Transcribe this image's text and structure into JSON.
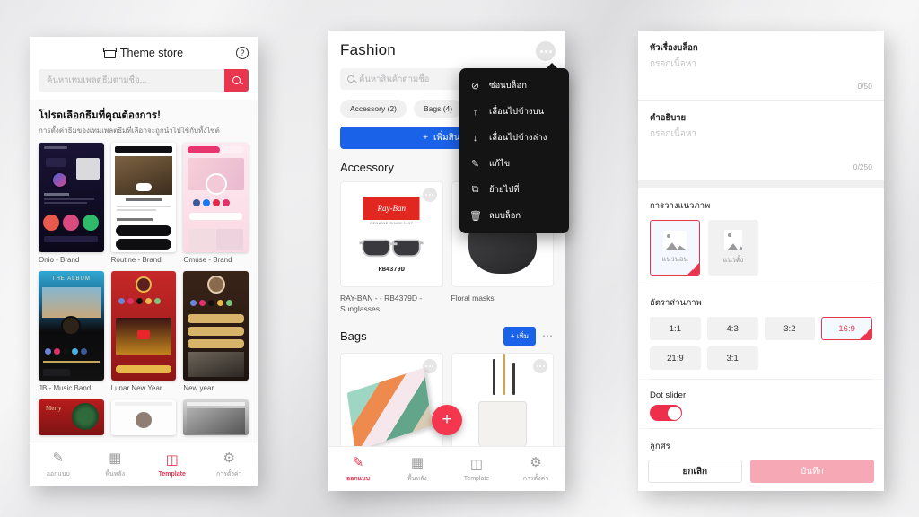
{
  "theme_store": {
    "title": "Theme store",
    "store_icon": "store-icon",
    "help_icon": "question-mark-icon",
    "search_placeholder": "ค้นหาเทมเพลตธีมตามชื่อ...",
    "search_icon": "search-icon",
    "heading": "โปรดเลือกธีมที่คุณต้องการ!",
    "subheading": "การตั้งค่าธีมของเทมเพลตธีมที่เลือกจะถูกนำไปใช้กับทั้งไซต์",
    "cards": [
      {
        "name": "Onio - Brand",
        "style": "th-onio"
      },
      {
        "name": "Routine - Brand",
        "style": "th-routine"
      },
      {
        "name": "Omuse - Brand",
        "style": "th-omuse"
      },
      {
        "name": "JB - Music Band",
        "style": "th-jb"
      },
      {
        "name": "Lunar New Year",
        "style": "th-lunar"
      },
      {
        "name": "New year",
        "style": "th-newyear"
      },
      {
        "name": "",
        "style": "th-xmas"
      },
      {
        "name": "",
        "style": "th-white"
      },
      {
        "name": "",
        "style": "th-gym"
      }
    ],
    "bottom_nav": [
      {
        "label": "ออกแบบ",
        "icon": "brush-icon",
        "glyph": "✎",
        "active": false
      },
      {
        "label": "พื้นหลัง",
        "icon": "image-icon",
        "glyph": "⛰",
        "active": false
      },
      {
        "label": "Template",
        "icon": "template-icon",
        "glyph": "◫",
        "active": true
      },
      {
        "label": "การตั้งค่า",
        "icon": "gear-icon",
        "glyph": "⚙",
        "active": false
      }
    ]
  },
  "fashion": {
    "title": "Fashion",
    "more_icon": "more-options-icon",
    "search_placeholder": "ค้นหาสินค้าตามชื่อ",
    "search_icon": "search-icon",
    "chips": [
      "Accessory (2)",
      "Bags (4)"
    ],
    "add_product_label": "เพิ่มสินค้า",
    "add_product_icon": "plus-icon",
    "sections": [
      {
        "title": "Accessory",
        "has_add": false,
        "products": [
          {
            "name": "RAY-BAN - - RB4379D - Sunglasses",
            "code": "RB4379D",
            "brand": "Ray-Ban",
            "kind": "sunglasses"
          },
          {
            "name": "Floral masks",
            "kind": "mask"
          }
        ]
      },
      {
        "title": "Bags",
        "has_add": true,
        "add_label": "เพิ่ม",
        "add_icon": "plus-icon",
        "more_icon": "more-options-icon",
        "products": [
          {
            "name": "",
            "kind": "notebook"
          },
          {
            "name": "",
            "kind": "pencilcup"
          }
        ]
      }
    ],
    "fab_icon": "plus-icon",
    "context_menu": [
      {
        "label": "ซ่อนบล็อก",
        "icon": "eye-off-icon",
        "glyph": "⊘"
      },
      {
        "label": "เลื่อนไปข้างบน",
        "icon": "arrow-up-icon",
        "glyph": "↑"
      },
      {
        "label": "เลื่อนไปข้างล่าง",
        "icon": "arrow-down-icon",
        "glyph": "↓"
      },
      {
        "label": "แก้ไข",
        "icon": "pencil-icon",
        "glyph": "✎"
      },
      {
        "label": "ย้ายไปที่",
        "icon": "move-to-folder-icon",
        "glyph": "⧉"
      },
      {
        "label": "ลบบล็อก",
        "icon": "trash-icon",
        "glyph": "Ὕ1"
      }
    ],
    "bottom_nav": [
      {
        "label": "ออกแบบ",
        "icon": "brush-icon",
        "glyph": "✎",
        "active": true
      },
      {
        "label": "พื้นหลัง",
        "icon": "image-icon",
        "glyph": "⛰",
        "active": false
      },
      {
        "label": "Template",
        "icon": "template-icon",
        "glyph": "◫",
        "active": false
      },
      {
        "label": "การตั้งค่า",
        "icon": "gear-icon",
        "glyph": "⚙",
        "active": false
      }
    ]
  },
  "settings": {
    "block_title_label": "หัวเรื่องบล็อก",
    "block_title_placeholder": "กรอกเนื้อหา",
    "block_title_counter": "0/50",
    "description_label": "คำอธิบาย",
    "description_placeholder": "กรอกเนื้อหา",
    "description_counter": "0/250",
    "orientation_label": "การวางแนวภาพ",
    "orientation_options": [
      {
        "label": "แนวนอน",
        "icon": "image-landscape-icon",
        "selected": true
      },
      {
        "label": "แนวตั้ง",
        "icon": "image-portrait-icon",
        "selected": false
      }
    ],
    "ratio_label": "อัตราส่วนภาพ",
    "ratios": [
      {
        "label": "1:1",
        "selected": false
      },
      {
        "label": "4:3",
        "selected": false
      },
      {
        "label": "3:2",
        "selected": false
      },
      {
        "label": "16:9",
        "selected": true
      },
      {
        "label": "21:9",
        "selected": false
      },
      {
        "label": "3:1",
        "selected": false
      }
    ],
    "dot_slider_label": "Dot slider",
    "dot_slider_on": true,
    "arrow_label": "ลูกศร",
    "arrow_on": true,
    "cancel_label": "ยกเลิก",
    "save_label": "บันทึก"
  },
  "colors": {
    "accent_red": "#e8364f",
    "blue": "#1a62e8",
    "toggle_red": "#ed2f4b",
    "save_pink": "#f6a8b4",
    "menu_dark": "#141414"
  }
}
